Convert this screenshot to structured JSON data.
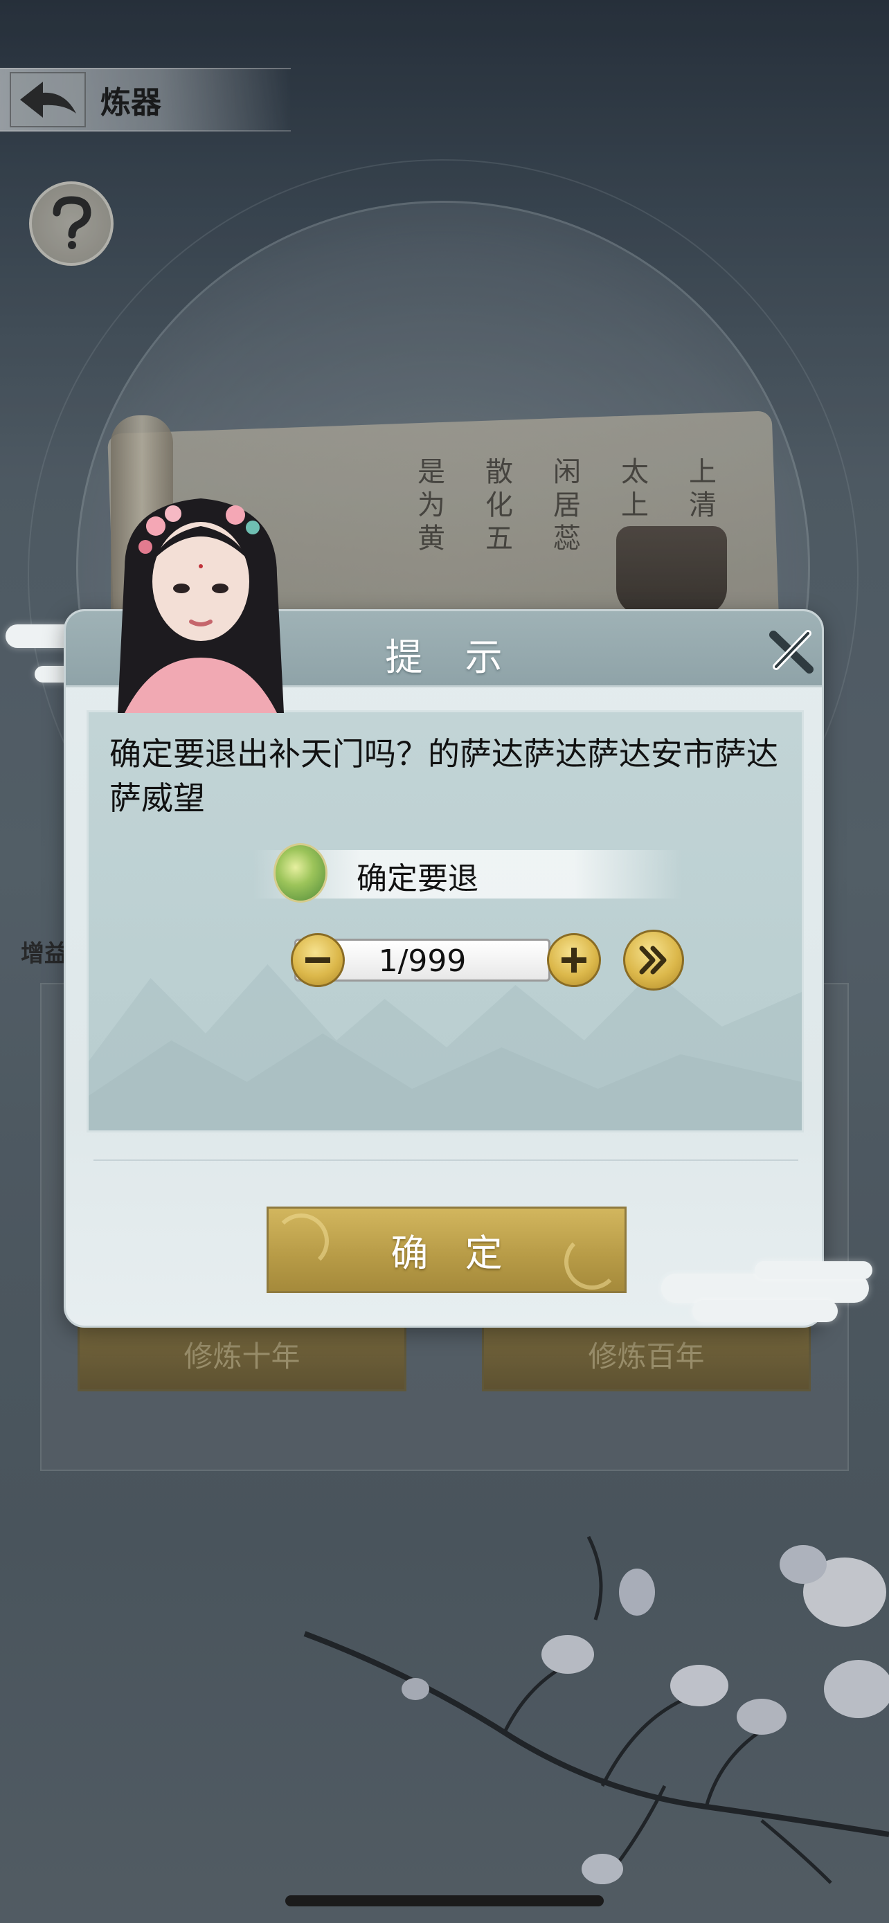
{
  "header": {
    "title": "炼器"
  },
  "background": {
    "scroll_text": [
      "上清",
      "太上",
      "闲居蕊",
      "散化五",
      "是为黄"
    ],
    "side_label": "增益",
    "buttons": [
      {
        "label": "修炼十年"
      },
      {
        "label": "修炼百年"
      }
    ]
  },
  "dialog": {
    "title": "提 示",
    "message": "确定要退出补天门吗？的萨达萨达萨达安市萨达萨威望",
    "item_name": "确定要退",
    "quantity": "1/999",
    "confirm_label": "确 定"
  },
  "colors": {
    "accent_gold": "#c9ad58",
    "header_teal": "#9fb2b6",
    "panel_bg": "#e4ecee"
  },
  "icons": [
    "back-arrow-icon",
    "question-icon",
    "close-x-icon",
    "minus-icon",
    "plus-icon",
    "double-chevron-right-icon",
    "jade-item-icon"
  ]
}
